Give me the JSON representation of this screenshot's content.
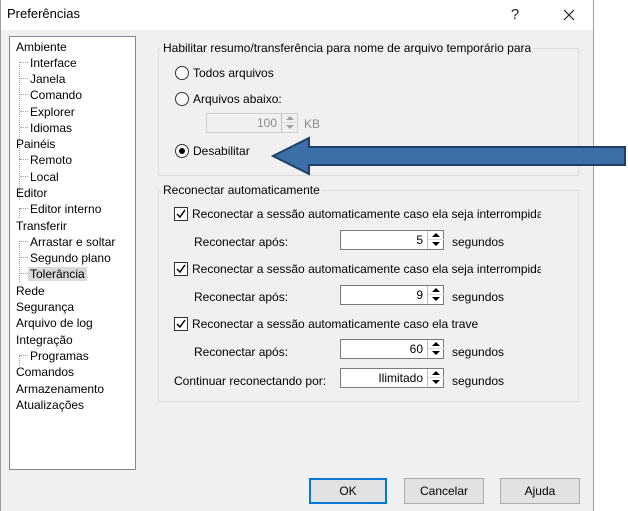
{
  "window": {
    "title": "Preferências",
    "help_glyph": "?",
    "close_icon": "close-icon"
  },
  "tree": {
    "items": [
      {
        "label": "Ambiente"
      },
      {
        "label": "Interface"
      },
      {
        "label": "Janela"
      },
      {
        "label": "Comando"
      },
      {
        "label": "Explorer"
      },
      {
        "label": "Idiomas"
      },
      {
        "label": "Painéis"
      },
      {
        "label": "Remoto"
      },
      {
        "label": "Local"
      },
      {
        "label": "Editor"
      },
      {
        "label": "Editor interno"
      },
      {
        "label": "Transferir"
      },
      {
        "label": "Arrastar e soltar"
      },
      {
        "label": "Segundo plano"
      },
      {
        "label": "Tolerância",
        "selected": true
      },
      {
        "label": "Rede"
      },
      {
        "label": "Segurança"
      },
      {
        "label": "Arquivo de log"
      },
      {
        "label": "Integração"
      },
      {
        "label": "Programas"
      },
      {
        "label": "Comandos"
      },
      {
        "label": "Armazenamento"
      },
      {
        "label": "Atualizações"
      }
    ]
  },
  "temp_group": {
    "title": "Habilitar resumo/transferência para nome de arquivo temporário para",
    "radio_all": "Todos arquivos",
    "radio_below": "Arquivos abaixo:",
    "size_value": "100",
    "size_unit": "KB",
    "radio_disable": "Desabilitar",
    "selected": "Desabilitar"
  },
  "reconnect_group": {
    "title": "Reconectar automaticamente",
    "check1": "Reconectar a sessão automaticamente caso ela seja interrompida d",
    "check1_checked": true,
    "after1_label": "Reconectar após:",
    "after1_value": "5",
    "check2": "Reconectar a sessão automaticamente caso ela seja interrompida e",
    "check2_checked": true,
    "after2_label": "Reconectar após:",
    "after2_value": "9",
    "check3": "Reconectar a sessão automaticamente caso ela trave",
    "check3_checked": true,
    "after3_label": "Reconectar após:",
    "after3_value": "60",
    "continue_label": "Continuar reconectando por:",
    "continue_value": "Ilimitado",
    "unit": "segundos"
  },
  "buttons": {
    "ok": "OK",
    "cancel": "Cancelar",
    "help": "Ajuda"
  },
  "annotation": {
    "arrow_color": "#3c6fa8",
    "arrow_outline": "#1f3f66"
  }
}
